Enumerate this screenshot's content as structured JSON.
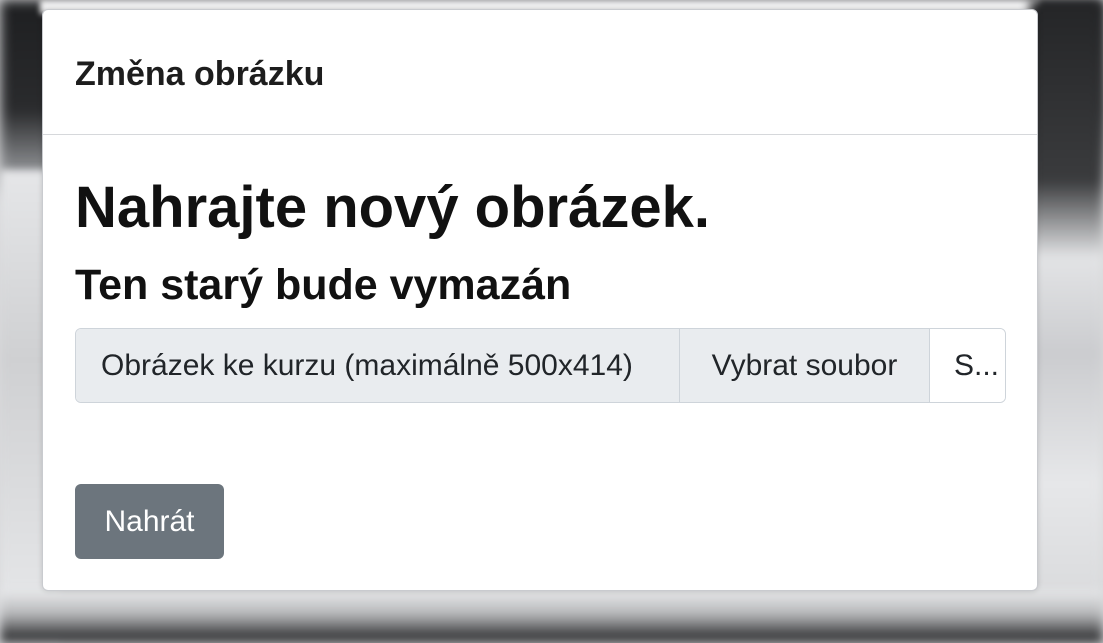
{
  "modal": {
    "title": "Změna obrázku",
    "heading": "Nahrajte nový obrázek.",
    "subheading": "Ten starý bude vymazán",
    "file_input": {
      "label": "Obrázek ke kurzu (maximálně 500x414)",
      "choose_label": "Vybrat soubor",
      "file_name": "S..."
    },
    "upload_label": "Nahrát"
  },
  "colors": {
    "button_secondary": "#6c757d",
    "input_group_bg": "#e9ecef"
  }
}
